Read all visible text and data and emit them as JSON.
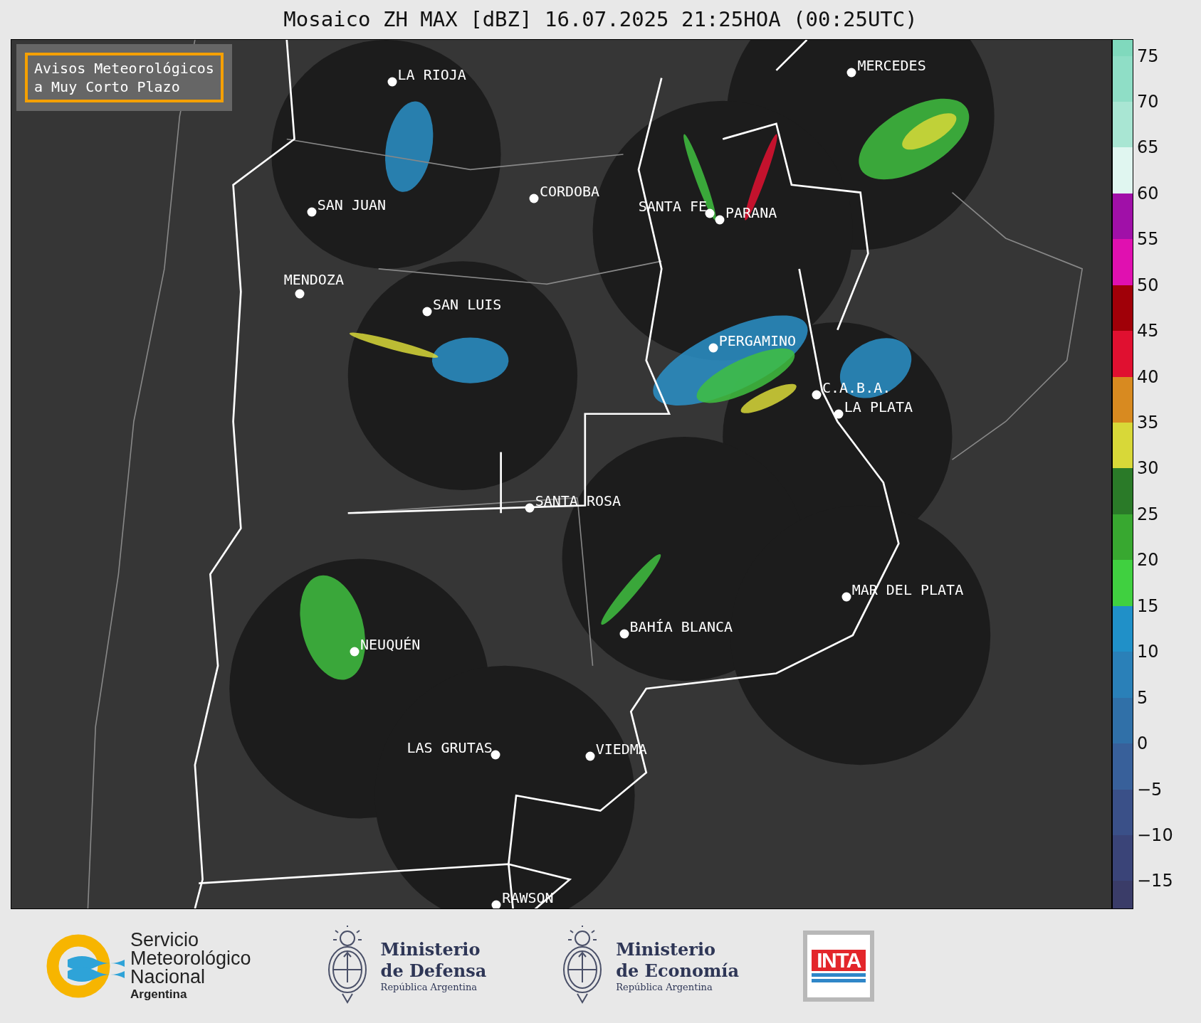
{
  "title": "Mosaico ZH MAX [dBZ] 16.07.2025 21:25HOA (00:25UTC)",
  "notice": [
    "Avisos Meteorológicos",
    "a Muy Corto Plazo"
  ],
  "cities": [
    {
      "name": "LA RIOJA"
    },
    {
      "name": "MERCEDES"
    },
    {
      "name": "CORDOBA"
    },
    {
      "name": "SAN JUAN"
    },
    {
      "name": "SANTA FE"
    },
    {
      "name": "PARANA"
    },
    {
      "name": "MENDOZA"
    },
    {
      "name": "SAN LUIS"
    },
    {
      "name": "PERGAMINO"
    },
    {
      "name": "C.A.B.A."
    },
    {
      "name": "LA PLATA"
    },
    {
      "name": "SANTA ROSA"
    },
    {
      "name": "MAR DEL PLATA"
    },
    {
      "name": "BAHÍA BLANCA"
    },
    {
      "name": "NEUQUÉN"
    },
    {
      "name": "LAS GRUTAS"
    },
    {
      "name": "VIEDMA"
    },
    {
      "name": "RAWSON"
    }
  ],
  "colorbar": {
    "ticks": [
      "75",
      "70",
      "65",
      "60",
      "55",
      "50",
      "45",
      "40",
      "35",
      "30",
      "25",
      "20",
      "15",
      "10",
      "5",
      "0",
      "−5",
      "−10",
      "−15"
    ],
    "bands": [
      {
        "color": "#80d9bd"
      },
      {
        "color": "#8fdec6"
      },
      {
        "color": "#a9e6d3"
      },
      {
        "color": "#e0f6f0"
      },
      {
        "color": "#a010a8"
      },
      {
        "color": "#e010b0"
      },
      {
        "color": "#a00008"
      },
      {
        "color": "#e01030"
      },
      {
        "color": "#d88a20"
      },
      {
        "color": "#d8d838"
      },
      {
        "color": "#2a7a28"
      },
      {
        "color": "#38a830"
      },
      {
        "color": "#40d040"
      },
      {
        "color": "#2090c8"
      },
      {
        "color": "#2a80b8"
      },
      {
        "color": "#3070a8"
      },
      {
        "color": "#38609a"
      },
      {
        "color": "#3a5088"
      },
      {
        "color": "#3a4478"
      },
      {
        "color": "#3a3c68"
      }
    ]
  },
  "logos": {
    "smn": [
      "Servicio",
      "Meteorológico",
      "Nacional",
      "Argentina"
    ],
    "defensa": [
      "Ministerio",
      "de Defensa",
      "República Argentina"
    ],
    "economia": [
      "Ministerio",
      "de Economía",
      "República Argentina"
    ],
    "inta": "INTA"
  }
}
